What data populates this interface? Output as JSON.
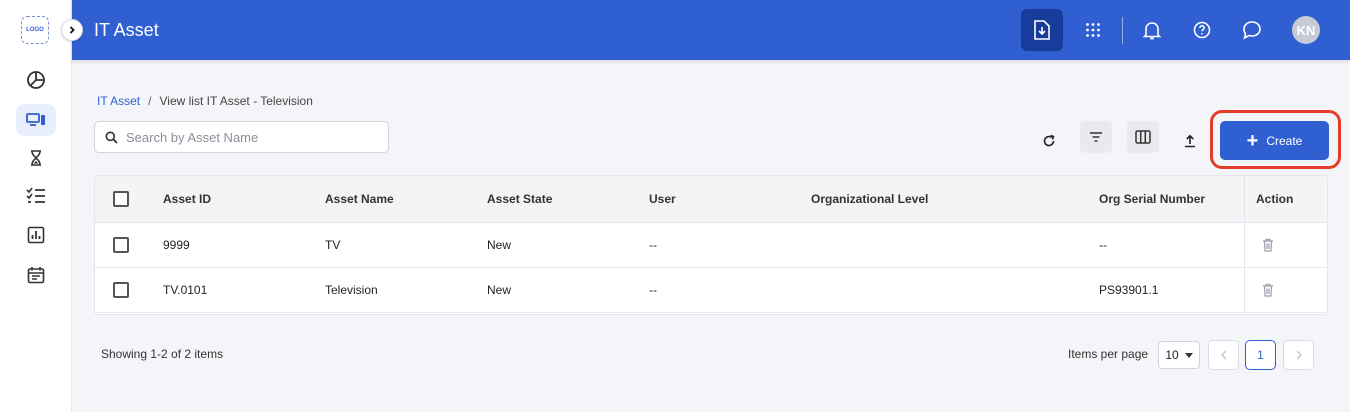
{
  "sidebar": {
    "logo": "LOGO",
    "items": [
      {
        "name": "dashboard",
        "icon": "pie-chart-icon"
      },
      {
        "name": "devices",
        "icon": "devices-icon",
        "active": true
      },
      {
        "name": "hourglass",
        "icon": "hourglass-icon"
      },
      {
        "name": "checklist",
        "icon": "checklist-icon"
      },
      {
        "name": "reports",
        "icon": "bar-chart-icon"
      },
      {
        "name": "calendar",
        "icon": "calendar-icon"
      }
    ]
  },
  "header": {
    "title": "IT Asset",
    "avatar": "KN",
    "color": "#2f5fd0"
  },
  "breadcrumb": {
    "root": "IT Asset",
    "separator": "/",
    "current": "View list IT Asset - Television"
  },
  "search": {
    "placeholder": "Search by Asset Name",
    "value": ""
  },
  "toolbar": {
    "create_label": "Create"
  },
  "table": {
    "columns": [
      "Asset ID",
      "Asset Name",
      "Asset State",
      "User",
      "Organizational Level",
      "Org Serial Number",
      "Action"
    ],
    "rows": [
      {
        "asset_id": "9999",
        "asset_name": "TV",
        "asset_state": "New",
        "user": "--",
        "org_level": "",
        "org_serial": "--"
      },
      {
        "asset_id": "TV.0101",
        "asset_name": "Television",
        "asset_state": "New",
        "user": "--",
        "org_level": "",
        "org_serial": "PS93901.1"
      }
    ]
  },
  "footer": {
    "showing": "Showing 1-2 of 2 items",
    "items_per_page_label": "Items per page",
    "items_per_page": "10",
    "current_page": "1"
  }
}
